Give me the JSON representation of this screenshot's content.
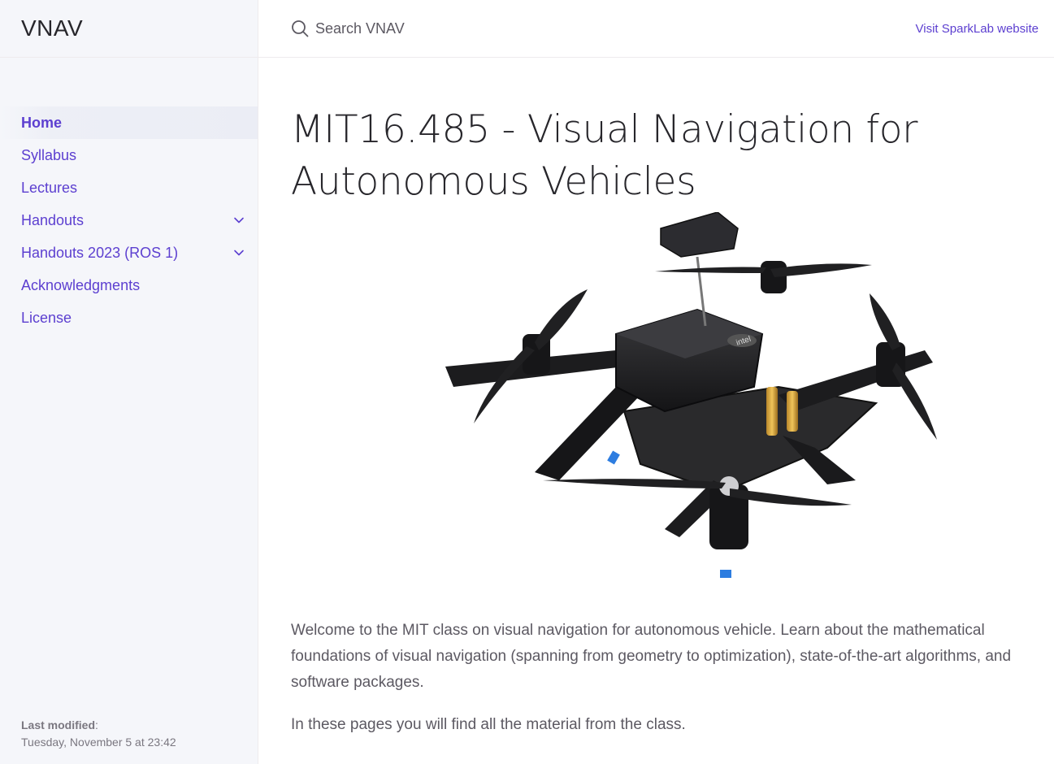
{
  "site": {
    "title": "VNAV"
  },
  "search": {
    "placeholder": "Search VNAV"
  },
  "aux_link": "Visit SparkLab website",
  "nav": [
    {
      "label": "Home",
      "active": true,
      "expandable": false
    },
    {
      "label": "Syllabus",
      "active": false,
      "expandable": false
    },
    {
      "label": "Lectures",
      "active": false,
      "expandable": false
    },
    {
      "label": "Handouts",
      "active": false,
      "expandable": true
    },
    {
      "label": "Handouts 2023 (ROS 1)",
      "active": false,
      "expandable": true
    },
    {
      "label": "Acknowledgments",
      "active": false,
      "expandable": false
    },
    {
      "label": "License",
      "active": false,
      "expandable": false
    }
  ],
  "footer": {
    "label": "Last modified",
    "value": "Tuesday, November 5 at 23:42"
  },
  "page": {
    "title_line1": "MIT16.485 - Visual Navigation for",
    "title_line2": "Autonomous Vehicles",
    "paragraph1": "Welcome to the MIT class on visual navigation for autonomous vehicle. Learn about the mathematical foundations of visual navigation (spanning from geometry to optimization), state-of-the-art algorithms, and software packages.",
    "paragraph2": "In these pages you will find all the material from the class.",
    "hero_logo_text": "intel"
  },
  "colors": {
    "accent": "#5c3fd0",
    "sidebar_bg": "#f5f6fa",
    "text": "#27262b",
    "muted": "#5c5962"
  },
  "icons": {
    "search": "search-icon",
    "expand": "chevron-down-icon"
  }
}
